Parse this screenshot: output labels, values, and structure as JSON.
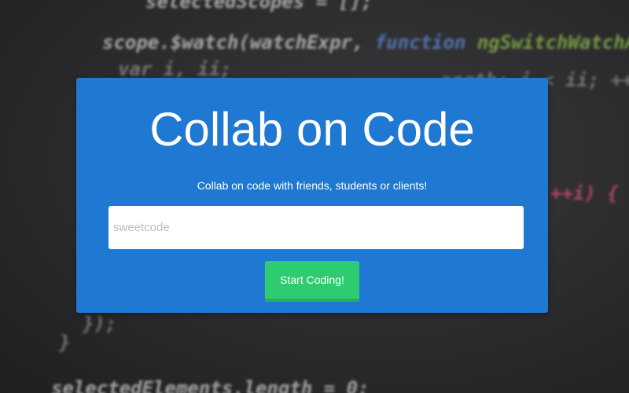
{
  "hero": {
    "title": "Collab on Code",
    "subtitle": "Collab on code with friends, students or clients!",
    "input_placeholder": "sweetcode",
    "input_value": "",
    "button_label": "Start Coding!"
  },
  "background_code": {
    "lines": [
      "selectedScopes = [];",
      "scope.$watch(watchExpr,",
      "function",
      "ngSwitchWatchAction(v",
      "var i, ii;",
      "ength; i < ii; ++i",
      "++i) {",
      "});",
      "}",
      "selectedElements.length = 0;"
    ]
  },
  "colors": {
    "panel": "#1f78d1",
    "button": "#2ecc71",
    "button_border": "#27ae60",
    "background": "#2a2a2c"
  }
}
